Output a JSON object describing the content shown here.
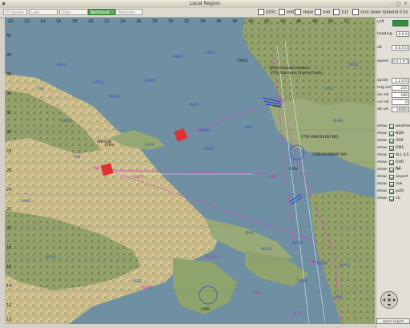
{
  "window": {
    "title": "Local Region"
  },
  "tabs": [
    {
      "label": "Hi Speed",
      "active": false
    },
    {
      "label": "Low Enroute",
      "active": false
    },
    {
      "label": "High Enroute",
      "active": false
    },
    {
      "label": "Sectional",
      "active": true
    },
    {
      "label": "Textured",
      "active": false
    }
  ],
  "toolbar": {
    "ids_label": "[ID5]",
    "edit_label": "edit",
    "slope_label": "slope",
    "mel_label": "mel",
    "fd_label": "3-D",
    "shutdown_label": "shut down tailwind 0.5s"
  },
  "panel": {
    "ucft_label": "ucft",
    "heading_label": "heading",
    "heading_value": "0 0 0",
    "alt_label": "alt",
    "alt_value": "0.0.0.0",
    "speed_label": "speed",
    "speed_value": "0.0.2.9.5",
    "aprotr_label": "aprotr",
    "aprotr_value": "1.2.0.0",
    "hdg_sel_label": "hdg sel",
    "hdg_sel_value": "225",
    "ias_sel_label": "ias sel",
    "ias_sel_value": "180",
    "vvi_sel_label": "vvi sel",
    "vvi_sel_value": "0",
    "alt_sel_label": "alt sel",
    "alt_sel_value": "10000",
    "show_label": "show",
    "layers": [
      {
        "label": "weather",
        "checked": true
      },
      {
        "label": "NDB",
        "checked": true
      },
      {
        "label": "VOR",
        "checked": true
      },
      {
        "label": "DME",
        "checked": true
      },
      {
        "label": "ALL ILS",
        "checked": true
      },
      {
        "label": "OUR ILS",
        "checked": true
      },
      {
        "label": "fix",
        "checked": true
      },
      {
        "label": "airport",
        "checked": true
      },
      {
        "label": "row",
        "checked": true
      },
      {
        "label": "path",
        "checked": true
      },
      {
        "label": "ctr",
        "checked": true
      }
    ],
    "zoom_label": "zoom airport"
  },
  "map": {
    "grid_top": [
      "10",
      "12",
      "14",
      "16",
      "18",
      "20",
      "22",
      "24",
      "26",
      "28",
      "30",
      "32",
      "34",
      "36",
      "38",
      "40",
      "42",
      "44",
      "46",
      "48",
      "50",
      "52"
    ],
    "grid_left": [
      "41",
      "38",
      "36",
      "34",
      "32",
      "30",
      "28",
      "26",
      "24",
      "22",
      "20",
      "18",
      "16",
      "14",
      "12",
      "10"
    ],
    "labels_black": [
      "CYHC Vancouver Harbour",
      "CYVV Vancouver Science Center",
      "CYAA2",
      "CYHC",
      "OREGON",
      "CYNS",
      "CYVR VANCOUVER INTL",
      "CZBB BOUNDARY BAY",
      "CYXX",
      "CYBD"
    ],
    "labels_pink": [
      "ABA",
      "ROUTE",
      "EBBY",
      "ROUTE ALT",
      "YVRD",
      "NEWPT",
      "DRICE",
      "ACRY"
    ],
    "labels_blue": [
      "HATSA",
      "OYTUD",
      "ARIRD",
      "PALAT",
      "SHAM",
      "LOALS",
      "BAILL",
      "TOQ",
      "LDGRD",
      "FRONS",
      "WIST",
      "HOVEY",
      "GUPE",
      "ITUN",
      "DIXIE",
      "BALLF",
      "NOPEE",
      "ROLLE",
      "TOPPE",
      "LOWE",
      "DEER",
      "SATOR",
      "DANSI",
      "MESAS",
      "KLLR",
      "ROCE",
      "BLAIN"
    ]
  }
}
